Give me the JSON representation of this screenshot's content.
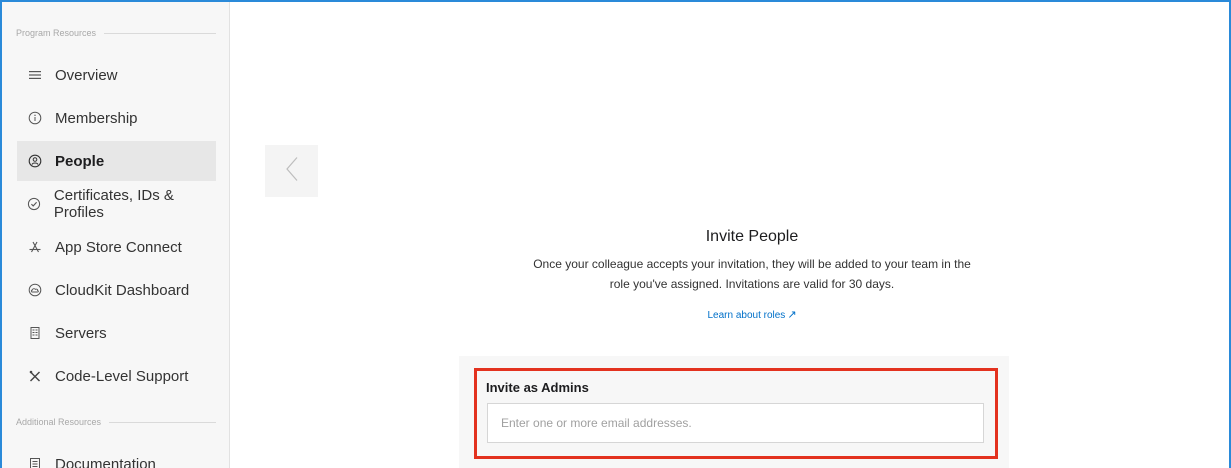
{
  "sidebar": {
    "program_header": "Program Resources",
    "additional_header": "Additional Resources",
    "items": [
      {
        "label": "Overview",
        "icon": "list-icon"
      },
      {
        "label": "Membership",
        "icon": "info-circle-icon"
      },
      {
        "label": "People",
        "icon": "people-circle-icon",
        "active": true
      },
      {
        "label": "Certificates, IDs & Profiles",
        "icon": "badge-check-icon"
      },
      {
        "label": "App Store Connect",
        "icon": "app-store-icon"
      },
      {
        "label": "CloudKit Dashboard",
        "icon": "cloud-icon"
      },
      {
        "label": "Servers",
        "icon": "server-icon"
      },
      {
        "label": "Code-Level Support",
        "icon": "tools-icon"
      }
    ],
    "additional_items": [
      {
        "label": "Documentation",
        "icon": "document-icon"
      }
    ]
  },
  "main": {
    "back_icon": "chevron-left-icon",
    "title": "Invite People",
    "description_line1": "Once your colleague accepts your invitation, they will be added to your team in the",
    "description_line2": "role you've assigned. Invitations are valid for 30 days.",
    "learn_link": "Learn about roles",
    "learn_link_arrow": "↗",
    "invite_admins": {
      "label": "Invite as Admins",
      "placeholder": "Enter one or more email addresses.",
      "value": ""
    }
  },
  "colors": {
    "accent": "#2a8ad9",
    "link": "#0070c9",
    "highlight_border": "#e3321f",
    "sidebar_bg": "#f7f7f7",
    "active_item_bg": "#e7e7e7"
  }
}
